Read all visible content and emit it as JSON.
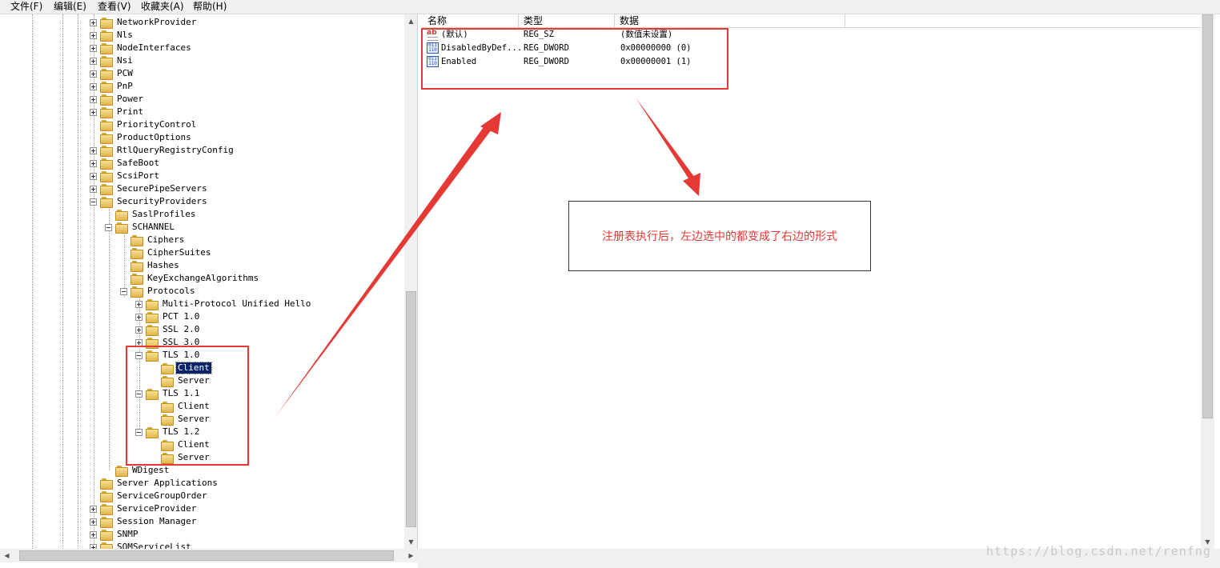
{
  "menu": {
    "file": "文件(F)",
    "edit": "编辑(E)",
    "view": "查看(V)",
    "favorites": "收藏夹(A)",
    "help": "帮助(H)"
  },
  "tree": {
    "selected": "Client",
    "items": [
      {
        "label": "NetworkProvider",
        "expander": "plus"
      },
      {
        "label": "Nls",
        "expander": "plus"
      },
      {
        "label": "NodeInterfaces",
        "expander": "plus"
      },
      {
        "label": "Nsi",
        "expander": "plus"
      },
      {
        "label": "PCW",
        "expander": "plus"
      },
      {
        "label": "PnP",
        "expander": "plus"
      },
      {
        "label": "Power",
        "expander": "plus"
      },
      {
        "label": "Print",
        "expander": "plus"
      },
      {
        "label": "PriorityControl",
        "expander": "none"
      },
      {
        "label": "ProductOptions",
        "expander": "none"
      },
      {
        "label": "RtlQueryRegistryConfig",
        "expander": "plus"
      },
      {
        "label": "SafeBoot",
        "expander": "plus"
      },
      {
        "label": "ScsiPort",
        "expander": "plus"
      },
      {
        "label": "SecurePipeServers",
        "expander": "plus"
      },
      {
        "label": "SecurityProviders",
        "expander": "minus"
      },
      {
        "label": "SaslProfiles",
        "expander": "none"
      },
      {
        "label": "SCHANNEL",
        "expander": "minus"
      },
      {
        "label": "Ciphers",
        "expander": "none"
      },
      {
        "label": "CipherSuites",
        "expander": "none"
      },
      {
        "label": "Hashes",
        "expander": "none"
      },
      {
        "label": "KeyExchangeAlgorithms",
        "expander": "none"
      },
      {
        "label": "Protocols",
        "expander": "minus"
      },
      {
        "label": "Multi-Protocol Unified Hello",
        "expander": "plus"
      },
      {
        "label": "PCT 1.0",
        "expander": "plus"
      },
      {
        "label": "SSL 2.0",
        "expander": "plus"
      },
      {
        "label": "SSL 3.0",
        "expander": "plus"
      },
      {
        "label": "TLS 1.0",
        "expander": "minus"
      },
      {
        "label": "Client",
        "expander": "none"
      },
      {
        "label": "Server",
        "expander": "none"
      },
      {
        "label": "TLS 1.1",
        "expander": "minus"
      },
      {
        "label": "Client",
        "expander": "none"
      },
      {
        "label": "Server",
        "expander": "none"
      },
      {
        "label": "TLS 1.2",
        "expander": "minus"
      },
      {
        "label": "Client",
        "expander": "none"
      },
      {
        "label": "Server",
        "expander": "none"
      },
      {
        "label": "WDigest",
        "expander": "none"
      },
      {
        "label": "Server Applications",
        "expander": "none"
      },
      {
        "label": "ServiceGroupOrder",
        "expander": "none"
      },
      {
        "label": "ServiceProvider",
        "expander": "plus"
      },
      {
        "label": "Session Manager",
        "expander": "plus"
      },
      {
        "label": "SNMP",
        "expander": "plus"
      },
      {
        "label": "SQMServiceList",
        "expander": "plus"
      }
    ]
  },
  "list": {
    "columns": {
      "name": "名称",
      "type": "类型",
      "data": "数据"
    },
    "rows": [
      {
        "icon": "reg-sz-icon",
        "name": "(默认)",
        "type": "REG_SZ",
        "data": "(数值未设置)"
      },
      {
        "icon": "reg-dword-icon",
        "name": "DisabledByDef...",
        "type": "REG_DWORD",
        "data": "0x00000000 (0)"
      },
      {
        "icon": "reg-dword-icon",
        "name": "Enabled",
        "type": "REG_DWORD",
        "data": "0x00000001 (1)"
      }
    ]
  },
  "annotation": {
    "note": "注册表执行后，左边选中的都变成了右边的形式",
    "color": "#e53935"
  },
  "watermark": "https://blog.csdn.net/renfng"
}
